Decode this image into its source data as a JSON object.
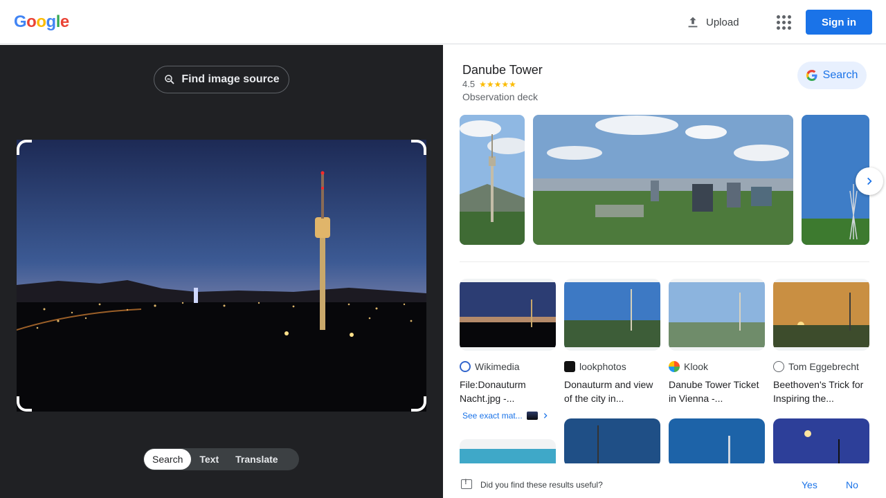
{
  "header": {
    "logo_letters": [
      "G",
      "o",
      "o",
      "g",
      "l",
      "e"
    ],
    "logo_colors": [
      "#4285f4",
      "#ea4335",
      "#fbbc05",
      "#4285f4",
      "#34a853",
      "#ea4335"
    ],
    "upload_label": "Upload",
    "signin_label": "Sign in"
  },
  "left": {
    "find_source_label": "Find image source",
    "tabs": [
      "Search",
      "Text",
      "Translate"
    ],
    "active_tab": "Search"
  },
  "knowledge_panel": {
    "title": "Danube Tower",
    "rating": "4.5",
    "stars": "★★★★★",
    "type": "Observation deck",
    "search_label": "Search"
  },
  "results": [
    {
      "source": "Wikimedia",
      "title": "File:Donauturm Nacht.jpg -..."
    },
    {
      "source": "lookphotos",
      "title": "Donauturm and view of the city in..."
    },
    {
      "source": "Klook",
      "title": "Danube Tower Ticket in Vienna -..."
    },
    {
      "source": "Tom Eggebrecht",
      "title": "Beethoven's Trick for Inspiring the..."
    }
  ],
  "exact_matches_label": "See exact mat...",
  "feedback": {
    "question": "Did you find these results useful?",
    "yes": "Yes",
    "no": "No"
  },
  "colors": {
    "accent": "#1a73e8",
    "dark_pane": "#202124"
  }
}
